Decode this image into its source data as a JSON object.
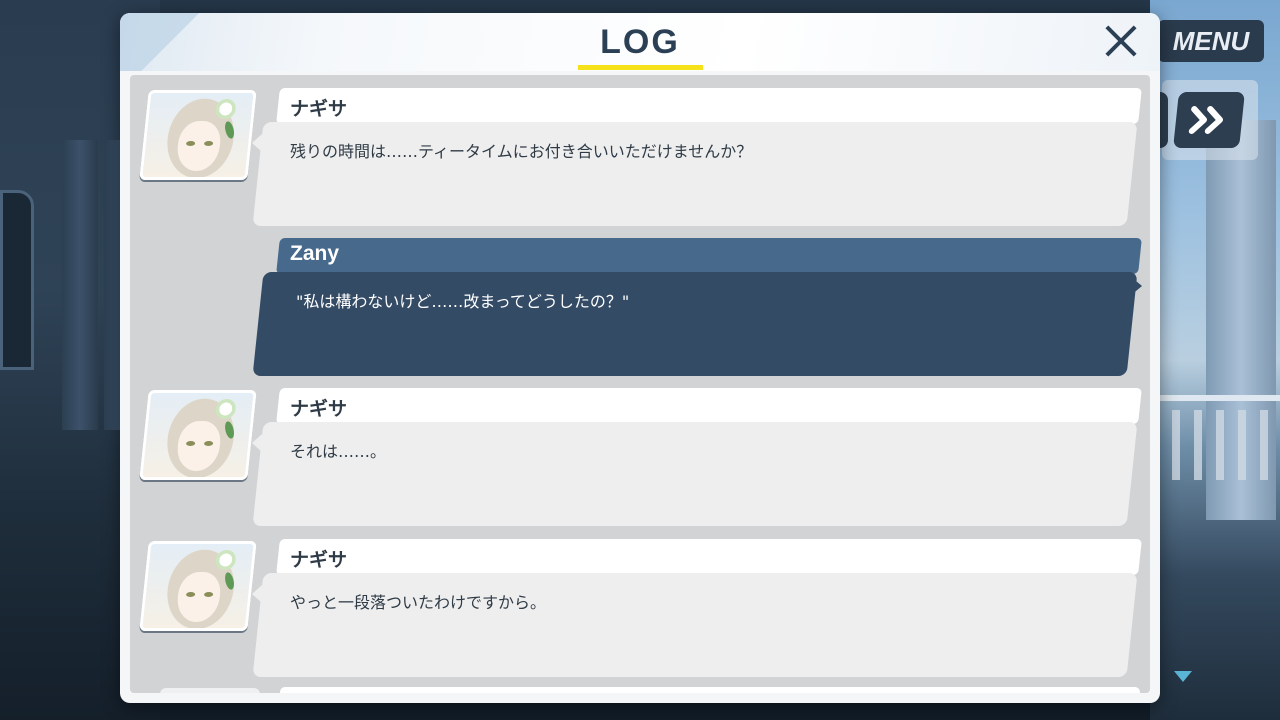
{
  "window": {
    "title": "LOG"
  },
  "hud": {
    "menu_label": "MENU"
  },
  "log": {
    "entries": [
      {
        "speaker": "ナギサ",
        "text": "残りの時間は……ティータイムにお付き合いいただけませんか？",
        "type": "npc"
      },
      {
        "speaker": "Zany",
        "text": "\"私は構わないけど……改まってどうしたの？\"",
        "type": "player"
      },
      {
        "speaker": "ナギサ",
        "text": "それは……。",
        "type": "npc"
      },
      {
        "speaker": "ナギサ",
        "text": "やっと一段落ついたわけですから。",
        "type": "npc"
      }
    ]
  },
  "colors": {
    "title": "#2b3f55",
    "title_underline": "#f5e21a",
    "player_name_bar": "#46698c",
    "player_message": "#344b66",
    "npc_message": "#eeeeee"
  }
}
